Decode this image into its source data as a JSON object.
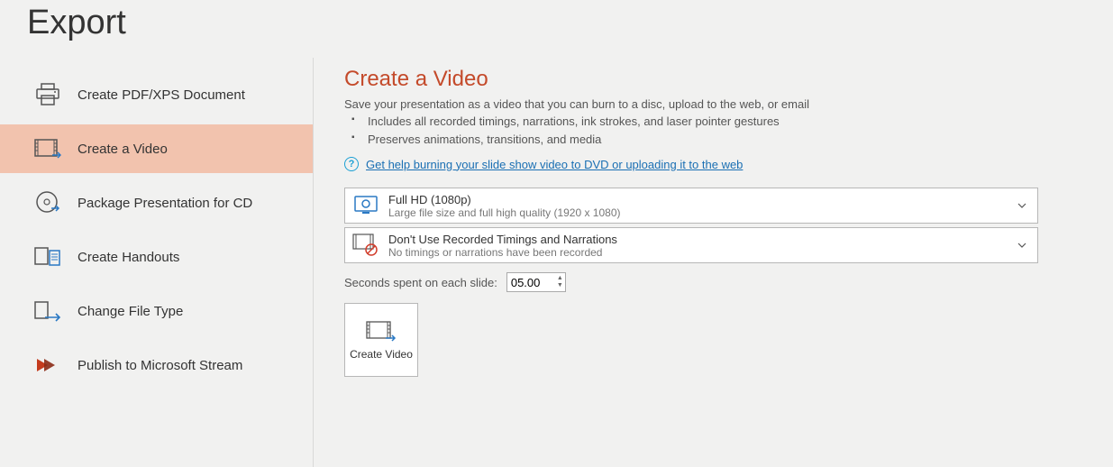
{
  "pageTitle": "Export",
  "sidebar": {
    "items": [
      {
        "label": "Create PDF/XPS Document",
        "iconName": "printer-icon"
      },
      {
        "label": "Create a Video",
        "iconName": "video-export-icon"
      },
      {
        "label": "Package Presentation for CD",
        "iconName": "cd-icon"
      },
      {
        "label": "Create Handouts",
        "iconName": "handouts-icon"
      },
      {
        "label": "Change File Type",
        "iconName": "change-file-icon"
      },
      {
        "label": "Publish to Microsoft Stream",
        "iconName": "stream-icon"
      }
    ],
    "selectedIndex": 1
  },
  "main": {
    "title": "Create a Video",
    "description": "Save your presentation as a video that you can burn to a disc, upload to the web, or email",
    "bullets": [
      "Includes all recorded timings, narrations, ink strokes, and laser pointer gestures",
      "Preserves animations, transitions, and media"
    ],
    "helpLink": "Get help burning your slide show video to DVD or uploading it to the web",
    "resolution": {
      "title": "Full HD (1080p)",
      "sub": "Large file size and full high quality (1920 x 1080)"
    },
    "timings": {
      "title": "Don't Use Recorded Timings and Narrations",
      "sub": "No timings or narrations have been recorded"
    },
    "secondsLabel": "Seconds spent on each slide:",
    "secondsValue": "05.00",
    "createButton": "Create Video"
  }
}
